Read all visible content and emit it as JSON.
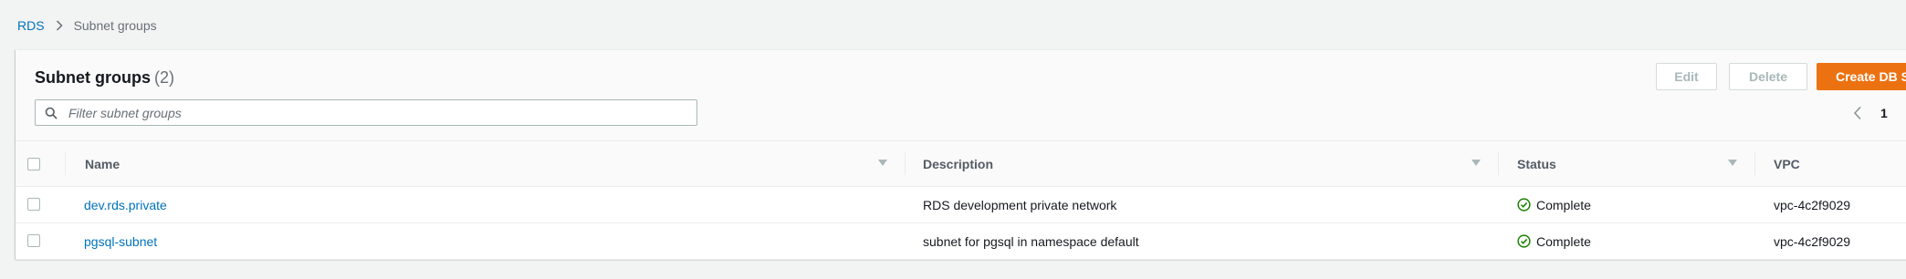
{
  "breadcrumb": {
    "root": "RDS",
    "current": "Subnet groups"
  },
  "panel": {
    "title": "Subnet groups",
    "count": "(2)",
    "search_placeholder": "Filter subnet groups",
    "buttons": {
      "edit": "Edit",
      "delete": "Delete",
      "create": "Create DB S"
    },
    "pagination": {
      "current_page": "1"
    }
  },
  "table": {
    "columns": [
      "Name",
      "Description",
      "Status",
      "VPC"
    ],
    "rows": [
      {
        "name": "dev.rds.private",
        "description": "RDS development private network",
        "status": "Complete",
        "vpc": "vpc-4c2f9029"
      },
      {
        "name": "pgsql-subnet",
        "description": "subnet for pgsql in namespace default",
        "status": "Complete",
        "vpc": "vpc-4c2f9029"
      }
    ]
  },
  "colors": {
    "link": "#0073bb",
    "primary_button": "#ec7211",
    "status_success": "#1d8102"
  },
  "icons": {
    "breadcrumb_separator": "chevron-right-icon",
    "search": "search-icon",
    "pagination_prev": "chevron-left-icon",
    "status": "check-circle-icon"
  }
}
